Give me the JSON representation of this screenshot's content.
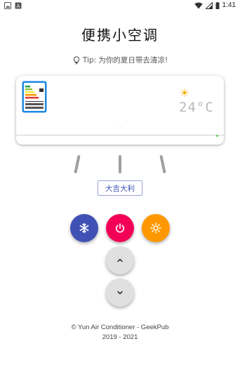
{
  "status_bar": {
    "time": "1:41"
  },
  "app": {
    "title": "便携小空调"
  },
  "tip": {
    "text": "Tip: 为你的夏日带去清凉!"
  },
  "ac_display": {
    "temperature": "24°C",
    "mode_icon": "sun-icon"
  },
  "lucky_tag": {
    "label": "大吉大利"
  },
  "controls": {
    "cool_icon": "snowflake-icon",
    "power_icon": "power-icon",
    "heat_icon": "sun-icon",
    "up_icon": "chevron-up-icon",
    "down_icon": "chevron-down-icon"
  },
  "footer": {
    "line1": "© Yun Air Conditioner - GeekPub",
    "line2": "2019 - 2021"
  },
  "colors": {
    "cool": "#3f51b5",
    "power": "#f50057",
    "heat": "#ff9800",
    "neutral": "#e0e0e0"
  }
}
